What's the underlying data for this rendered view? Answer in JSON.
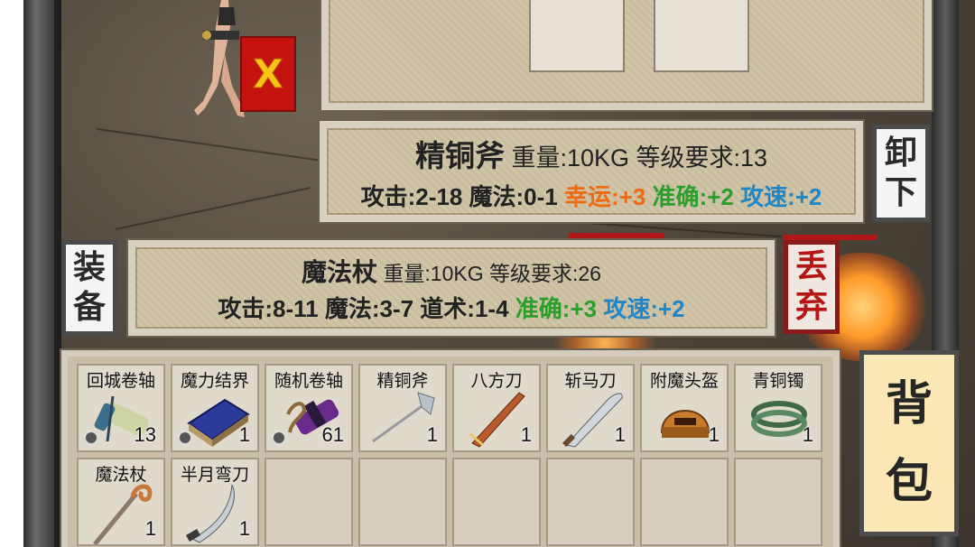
{
  "close_button": {
    "label": "X"
  },
  "equipped_tooltip": {
    "name": "精铜斧",
    "info": "重量:10KG 等级要求:13",
    "base_stats": "攻击:2-18 魔法:0-1",
    "luck": "幸运:+3",
    "accuracy": "准确:+2",
    "speed": "攻速:+2",
    "colors": {
      "luck": "#f06a10",
      "accuracy": "#2aa02a",
      "speed": "#1f86c8"
    }
  },
  "unload_button": {
    "char1": "卸",
    "char2": "下"
  },
  "hover_tooltip": {
    "name": "魔法杖",
    "info": "重量:10KG 等级要求:26",
    "base_stats": "攻击:8-11 魔法:3-7 道术:1-4",
    "accuracy": "准确:+3",
    "speed": "攻速:+2"
  },
  "equip_button": {
    "char1": "装",
    "char2": "备"
  },
  "discard_button": {
    "char1": "丢",
    "char2": "弃"
  },
  "backpack_button": {
    "char1": "背",
    "char2": "包"
  },
  "backpack": {
    "items": [
      {
        "name": "回城卷轴",
        "count": "13",
        "icon": "scroll-icon",
        "locked": true
      },
      {
        "name": "魔力结界",
        "count": "1",
        "icon": "book-icon",
        "locked": true
      },
      {
        "name": "随机卷轴",
        "count": "61",
        "icon": "purple-scroll-icon",
        "locked": true
      },
      {
        "name": "精铜斧",
        "count": "1",
        "icon": "axe-icon",
        "locked": false
      },
      {
        "name": "八方刀",
        "count": "1",
        "icon": "sword-icon",
        "locked": false
      },
      {
        "name": "斩马刀",
        "count": "1",
        "icon": "blade-icon",
        "locked": false
      },
      {
        "name": "附魔头盔",
        "count": "1",
        "icon": "helmet-icon",
        "locked": false
      },
      {
        "name": "青铜镯",
        "count": "1",
        "icon": "bracelet-icon",
        "locked": false
      },
      {
        "name": "魔法杖",
        "count": "1",
        "icon": "staff-icon",
        "locked": false
      },
      {
        "name": "半月弯刀",
        "count": "1",
        "icon": "curved-blade-icon",
        "locked": false
      }
    ]
  }
}
